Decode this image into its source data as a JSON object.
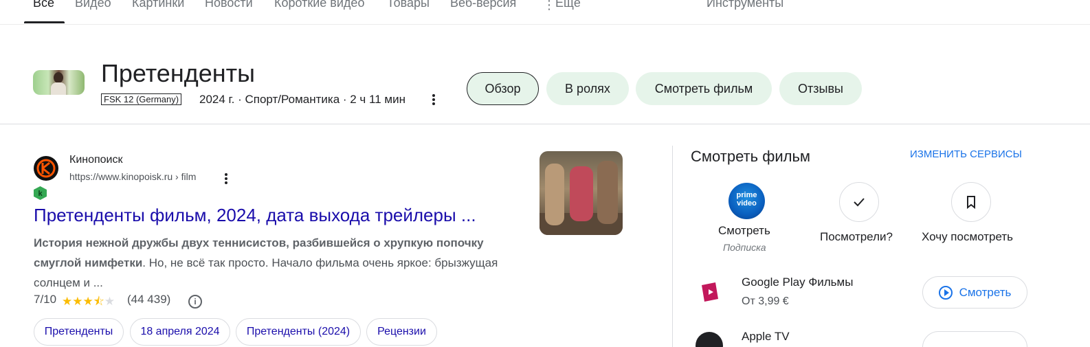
{
  "tabs": {
    "items": [
      "Все",
      "Видео",
      "Картинки",
      "Новости",
      "Короткие видео",
      "Товары",
      "Веб-версия",
      "Ещё"
    ],
    "tools": "Инструменты"
  },
  "entity": {
    "title": "Претенденты",
    "age_rating": "FSK 12 (Germany)",
    "meta": "2024 г. · Спорт/Романтика · 2 ч 11 мин",
    "chips": [
      "Обзор",
      "В ролях",
      "Смотреть фильм",
      "Отзывы"
    ]
  },
  "result": {
    "site_name": "Кинопоиск",
    "url": "https://www.kinopoisk.ru › film",
    "title": "Претенденты фильм, 2024, дата выхода трейлеры ...",
    "snippet_bold": "История нежной дружбы двух теннисистов, разбившейся о хрупкую попочку смуглой нимфетки",
    "snippet_rest": ". Но, не всё так просто. Начало фильма очень яркое: брызжущая солнцем и ...",
    "rating": "7/10",
    "stars": 3.5,
    "review_count": "(44 439)",
    "sitelinks": [
      "Претенденты",
      "18 апреля 2024",
      "Претенденты (2024)",
      "Рецензии"
    ]
  },
  "watch_panel": {
    "title": "Смотреть фильм",
    "change_services": "ИЗМЕНИТЬ СЕРВИСЫ",
    "prime_logo": "prime video",
    "prime_label": "Смотреть",
    "prime_sub": "Подписка",
    "watched_label": "Посмотрели?",
    "want_label": "Хочу посмотреть",
    "providers": [
      {
        "name": "Google Play Фильмы",
        "price": "От 3,99 €",
        "button": "Смотреть"
      },
      {
        "name": "Apple TV"
      }
    ]
  },
  "colors": {
    "link": "#1a0dab",
    "accent_blue": "#1a73e8",
    "chip_bg": "#e6f4ea",
    "star": "#fbbc04"
  }
}
